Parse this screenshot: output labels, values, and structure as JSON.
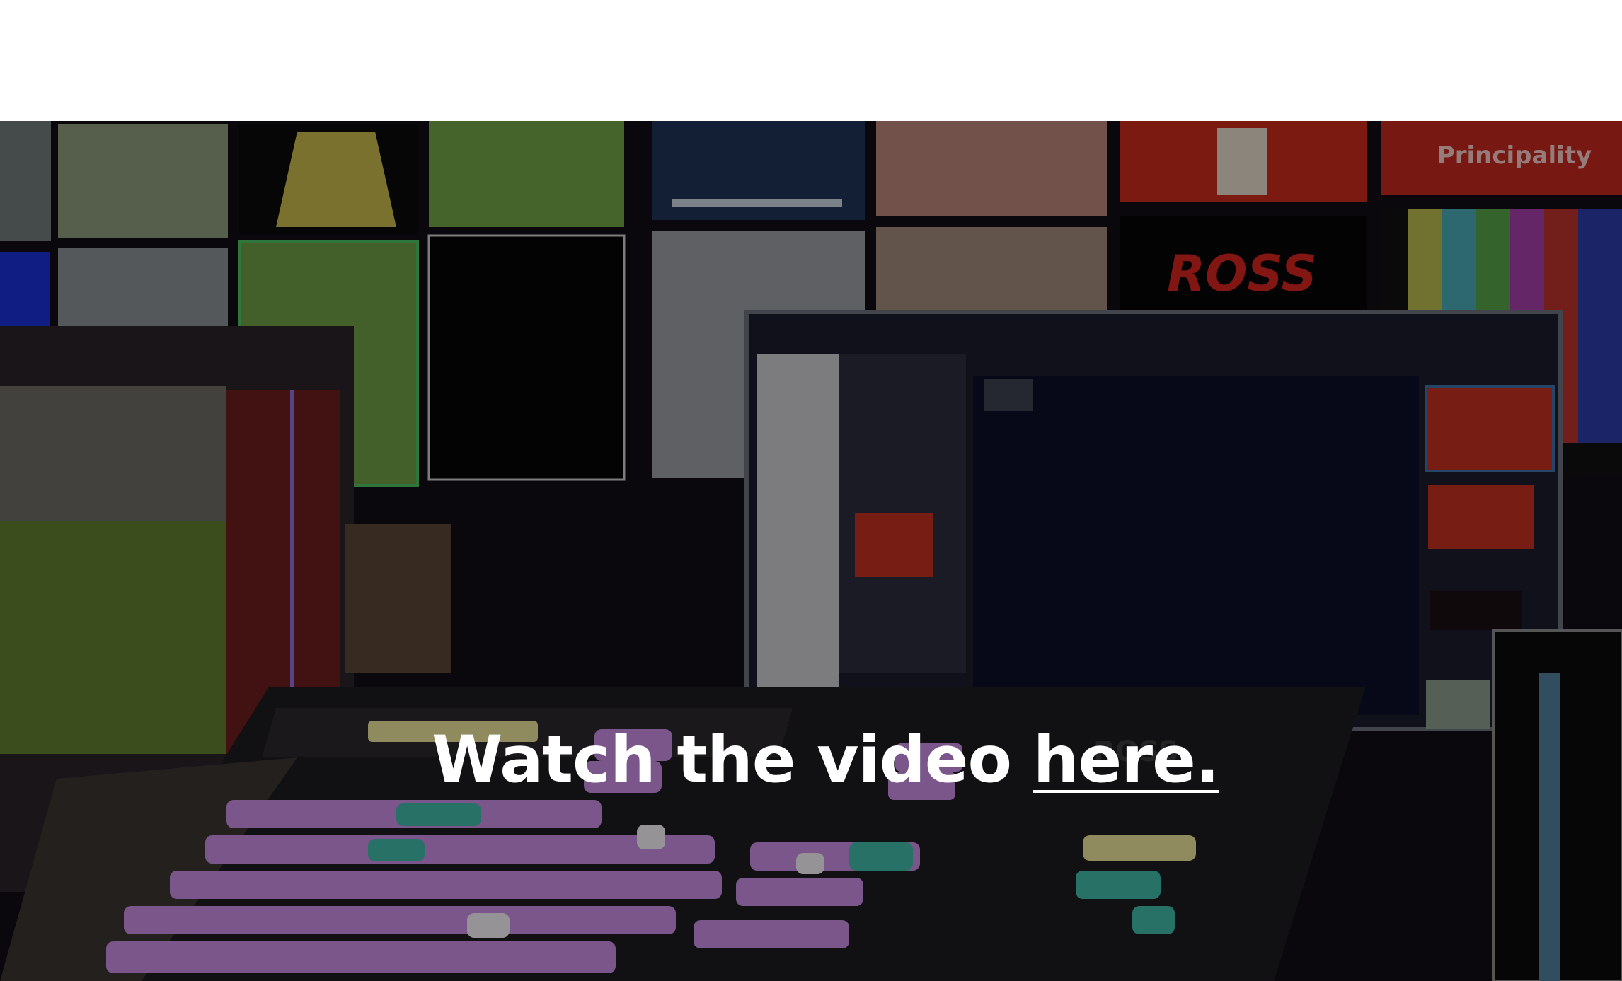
{
  "hero": {
    "headline_prefix": "Watch the video ",
    "headline_link": "here.",
    "overlay_color": "#000000",
    "monitor_wall_text": {
      "brand": "ROSS",
      "venue": "Principality",
      "desk_brand": "ROSS"
    }
  },
  "colors": {
    "background": "#ffffff",
    "hero_dark": "#0e0a12",
    "headline": "#ffffff",
    "red_screen": "#c62a1c",
    "pitch_green": "#7aa83a",
    "button_purple": "#c58be0",
    "button_teal": "#3fb6a7"
  }
}
